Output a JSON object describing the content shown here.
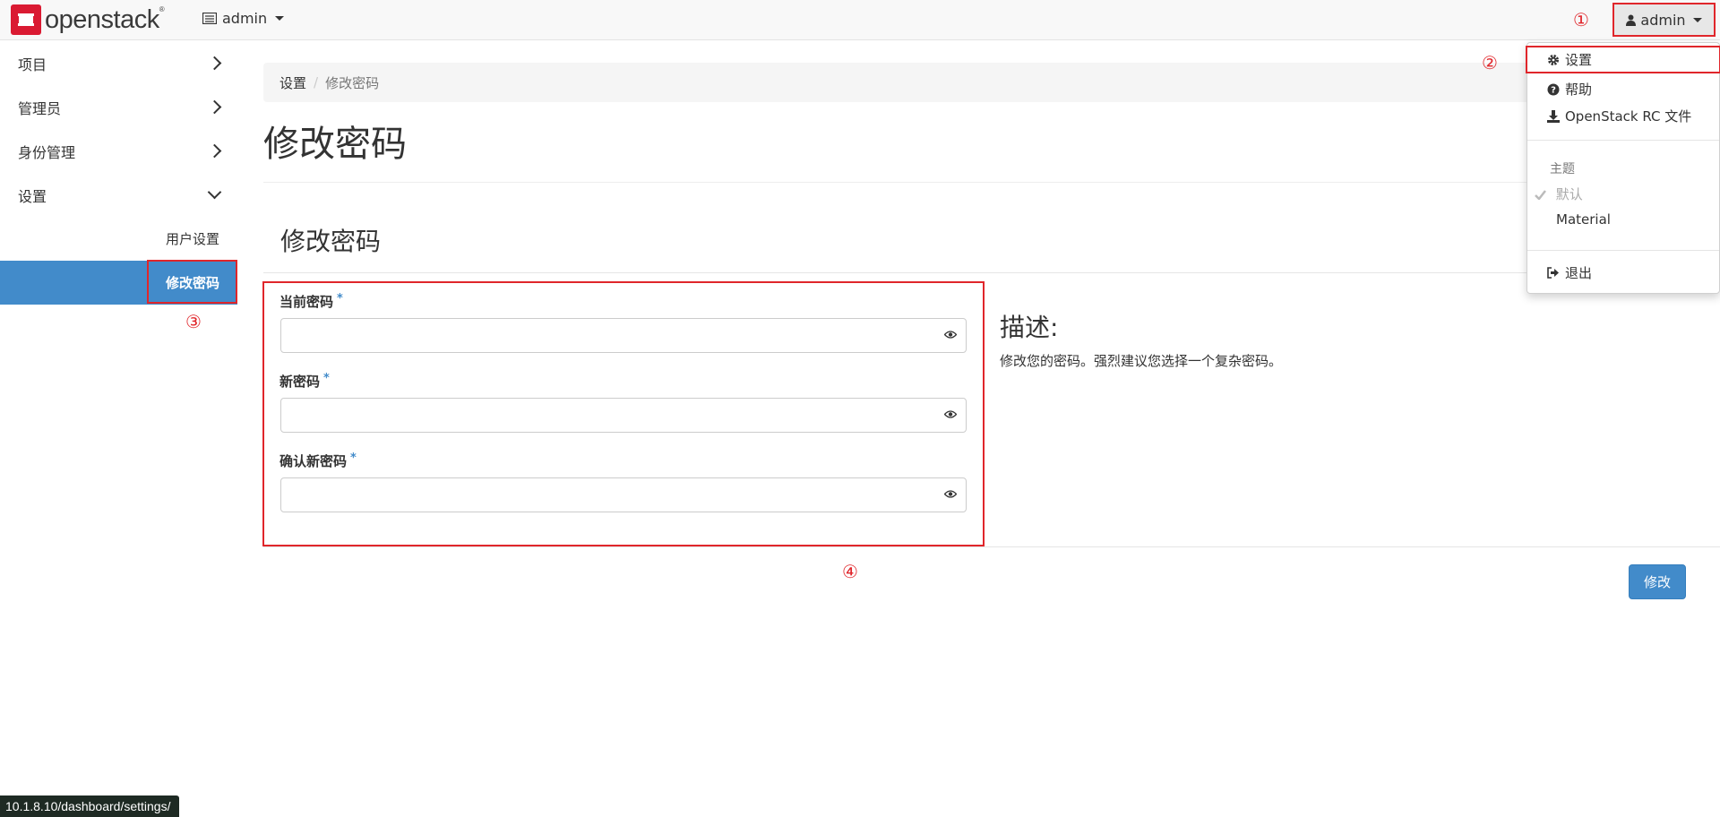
{
  "topbar": {
    "logo_text": "openstack",
    "logo_mark": "®",
    "project": "admin",
    "user": "admin",
    "markers": [
      "①",
      "②",
      "③",
      "④"
    ]
  },
  "sidebar": {
    "items": [
      {
        "label": "项目",
        "icon": "chevron-right-icon"
      },
      {
        "label": "管理员",
        "icon": "chevron-right-icon"
      },
      {
        "label": "身份管理",
        "icon": "chevron-right-icon"
      },
      {
        "label": "设置",
        "icon": "chevron-down-icon"
      }
    ],
    "sub_items": [
      {
        "label": "用户设置"
      },
      {
        "label": "修改密码",
        "active": true
      }
    ]
  },
  "breadcrumb": {
    "parent": "设置",
    "separator": "/",
    "current": "修改密码"
  },
  "page_title": "修改密码",
  "modal": {
    "title": "修改密码",
    "fields": [
      {
        "label": "当前密码",
        "value": ""
      },
      {
        "label": "新密码",
        "value": ""
      },
      {
        "label": "确认新密码",
        "value": ""
      }
    ],
    "required_mark": "*",
    "desc_title": "描述:",
    "desc_text": "修改您的密码。强烈建议您选择一个复杂密码。",
    "submit_label": "修改"
  },
  "dropdown": {
    "settings": "设置",
    "help": "帮助",
    "rc_file": "OpenStack RC 文件",
    "theme_header": "主题",
    "theme_default": "默认",
    "theme_material": "Material",
    "logout": "退出"
  },
  "status_url": "10.1.8.10/dashboard/settings/",
  "colors": {
    "primary": "#428bca",
    "annotation_red": "#e0262b",
    "logo_red": "#da1a32"
  }
}
